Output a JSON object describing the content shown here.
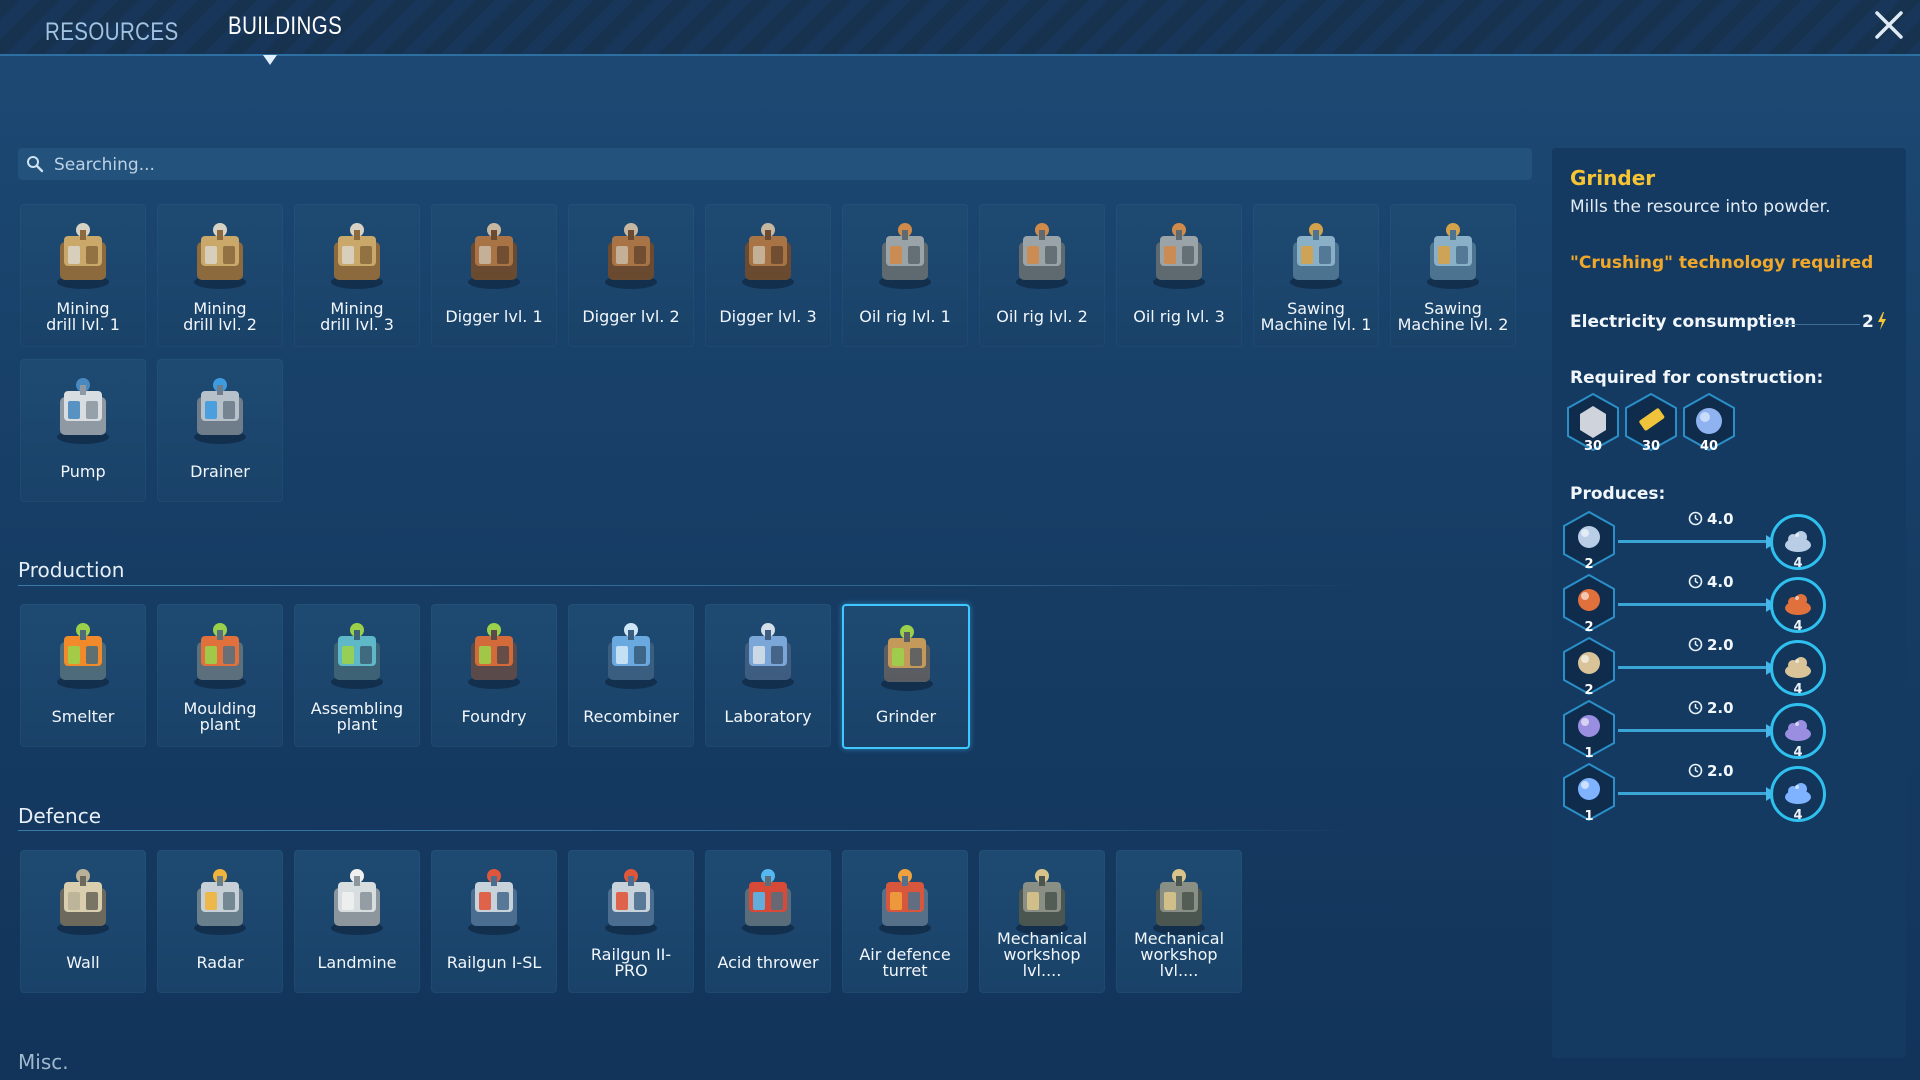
{
  "tabs": [
    {
      "label": "RESOURCES",
      "active": false
    },
    {
      "label": "BUILDINGS",
      "active": true
    }
  ],
  "search": {
    "placeholder": "Searching..."
  },
  "extraction": [
    {
      "label": "Mining\ndrill lvl. 1",
      "icon": "mining-drill"
    },
    {
      "label": "Mining\ndrill lvl. 2",
      "icon": "mining-drill"
    },
    {
      "label": "Mining\ndrill lvl. 3",
      "icon": "mining-drill"
    },
    {
      "label": "Digger lvl. 1",
      "icon": "digger"
    },
    {
      "label": "Digger lvl. 2",
      "icon": "digger"
    },
    {
      "label": "Digger lvl. 3",
      "icon": "digger"
    },
    {
      "label": "Oil rig lvl. 1",
      "icon": "oil-rig"
    },
    {
      "label": "Oil rig lvl. 2",
      "icon": "oil-rig"
    },
    {
      "label": "Oil rig lvl. 3",
      "icon": "oil-rig"
    },
    {
      "label": "Sawing\nMachine lvl. 1",
      "icon": "sawing-machine"
    },
    {
      "label": "Sawing\nMachine lvl. 2",
      "icon": "sawing-machine"
    },
    {
      "label": "Pump",
      "icon": "pump"
    },
    {
      "label": "Drainer",
      "icon": "drainer"
    }
  ],
  "production": {
    "title": "Production",
    "items": [
      {
        "label": "Smelter",
        "icon": "smelter"
      },
      {
        "label": "Moulding\nplant",
        "icon": "moulding-plant"
      },
      {
        "label": "Assembling\nplant",
        "icon": "assembling-plant"
      },
      {
        "label": "Foundry",
        "icon": "foundry"
      },
      {
        "label": "Recombiner",
        "icon": "recombiner"
      },
      {
        "label": "Laboratory",
        "icon": "laboratory"
      },
      {
        "label": "Grinder",
        "icon": "grinder",
        "selected": true
      }
    ]
  },
  "defence": {
    "title": "Defence",
    "items": [
      {
        "label": "Wall",
        "icon": "wall"
      },
      {
        "label": "Radar",
        "icon": "radar"
      },
      {
        "label": "Landmine",
        "icon": "landmine"
      },
      {
        "label": "Railgun I-SL",
        "icon": "railgun"
      },
      {
        "label": "Railgun II-\nPRO",
        "icon": "railgun"
      },
      {
        "label": "Acid thrower",
        "icon": "acid-thrower"
      },
      {
        "label": "Air defence\nturret",
        "icon": "air-defence-turret"
      },
      {
        "label": "Mechanical\nworkshop lvl....",
        "icon": "mechanical-workshop"
      },
      {
        "label": "Mechanical\nworkshop lvl....",
        "icon": "mechanical-workshop"
      }
    ]
  },
  "misc": {
    "title": "Misc."
  },
  "details": {
    "name": "Grinder",
    "description": "Mills the resource into powder.",
    "requirement": "\"Crushing\" technology required",
    "electricity_label": "Electricity consumption",
    "electricity_value": "2",
    "construction_label": "Required for construction:",
    "construction": [
      {
        "count": "30",
        "icon": "metal-plate-icon"
      },
      {
        "count": "30",
        "icon": "battery-icon"
      },
      {
        "count": "40",
        "icon": "crystal-orb-icon"
      }
    ],
    "produces_label": "Produces:",
    "produces": [
      {
        "input_count": "2",
        "time": "4.0",
        "output_count": "4",
        "color": "#b9cde6"
      },
      {
        "input_count": "2",
        "time": "4.0",
        "output_count": "4",
        "color": "#e0703c"
      },
      {
        "input_count": "2",
        "time": "2.0",
        "output_count": "4",
        "color": "#d9c49a"
      },
      {
        "input_count": "1",
        "time": "2.0",
        "output_count": "4",
        "color": "#9a8ee0"
      },
      {
        "input_count": "1",
        "time": "2.0",
        "output_count": "4",
        "color": "#7fb3ff"
      }
    ]
  },
  "colors": {
    "accent": "#3fc8ff",
    "title": "#f7c533",
    "warning": "#f1a82a"
  }
}
